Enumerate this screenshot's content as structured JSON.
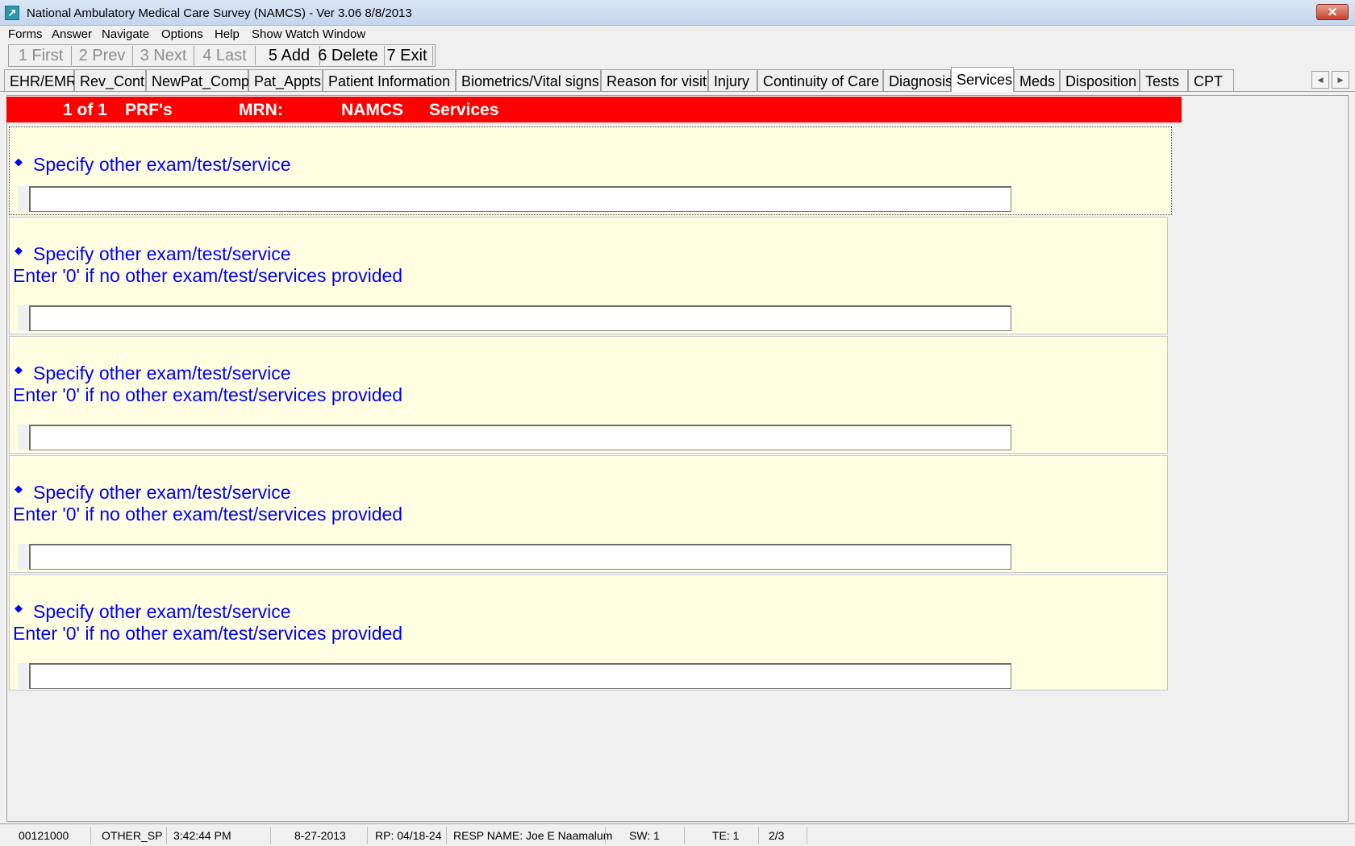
{
  "window": {
    "title": "National Ambulatory Medical Care Survey (NAMCS) - Ver 3.06 8/8/2013",
    "close_label": "✕"
  },
  "menu": [
    "Forms",
    "Answer",
    "Navigate",
    "Options",
    "Help",
    "Show Watch Window"
  ],
  "toolbar": [
    {
      "label": "1 First",
      "enabled": false
    },
    {
      "label": "2 Prev",
      "enabled": false
    },
    {
      "label": "3 Next",
      "enabled": false
    },
    {
      "label": "4 Last",
      "enabled": false
    },
    {
      "label": "5 Add",
      "enabled": true
    },
    {
      "label": "6 Delete",
      "enabled": true
    },
    {
      "label": "7 Exit",
      "enabled": true
    }
  ],
  "tabs": [
    "EHR/EMR",
    "Rev_Cont",
    "NewPat_Comp",
    "Pat_Appts",
    "Patient Information",
    "Biometrics/Vital signs",
    "Reason for visit",
    "Injury",
    "Continuity of Care",
    "Diagnosis",
    "Services",
    "Meds",
    "Disposition",
    "Tests",
    "CPT"
  ],
  "active_tab": "Services",
  "header": {
    "record": "1 of 1",
    "form": "PRF's",
    "mrn_label": "MRN:",
    "survey": "NAMCS",
    "section": "Services"
  },
  "questions": [
    {
      "label": "Specify other exam/test/service",
      "hint": "",
      "value": ""
    },
    {
      "label": "Specify other exam/test/service",
      "hint": "Enter '0' if no other exam/test/services provided",
      "value": ""
    },
    {
      "label": "Specify other exam/test/service",
      "hint": "Enter '0' if no other exam/test/services provided",
      "value": ""
    },
    {
      "label": "Specify other exam/test/service",
      "hint": "Enter '0' if no other exam/test/services provided",
      "value": ""
    },
    {
      "label": "Specify other exam/test/service",
      "hint": "Enter '0' if no other exam/test/services provided",
      "value": ""
    }
  ],
  "status": {
    "case_id": "00121000",
    "field_name": "OTHER_SP",
    "time": "3:42:44 PM",
    "date": "8-27-2013",
    "rp": "RP: 04/18-24",
    "resp_name": "RESP NAME: Joe E Naamalum",
    "sw": "SW: 1",
    "te": "TE: 1",
    "page": "2/3"
  }
}
